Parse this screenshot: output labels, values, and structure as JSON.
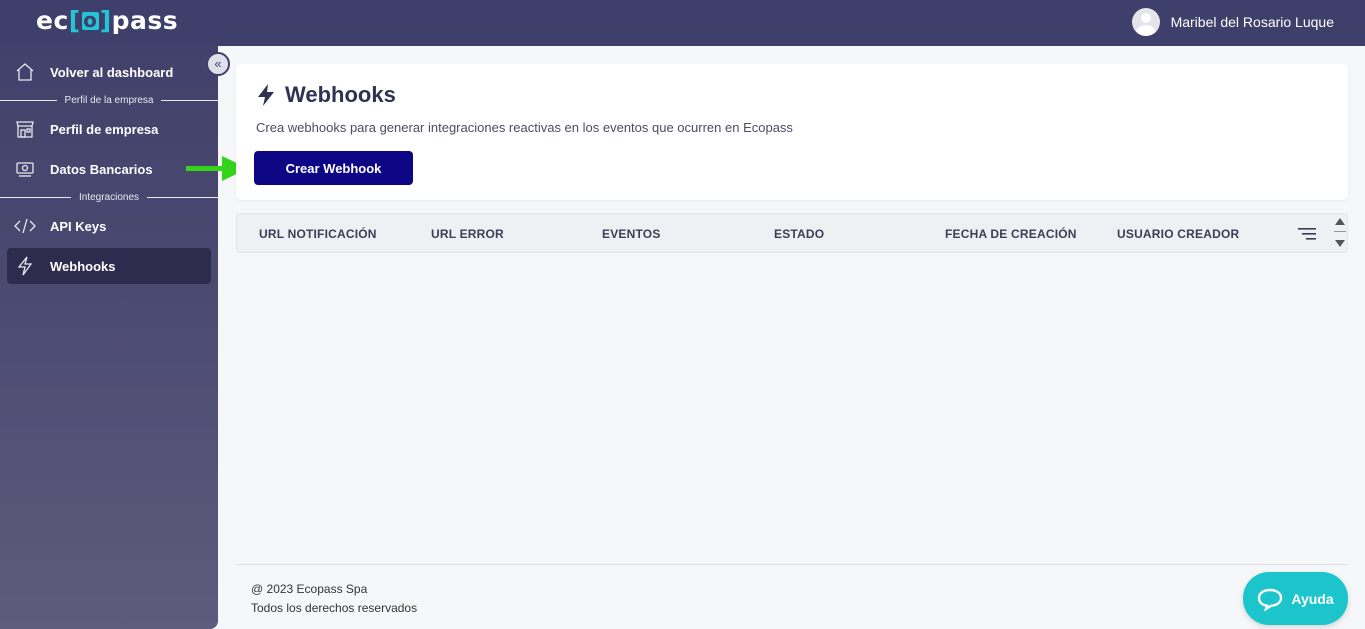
{
  "brand": {
    "logo_part1": "ec",
    "logo_bracket_open": "[",
    "logo_o": "o",
    "logo_bracket_close": "]",
    "logo_part2": "pass",
    "accent": "#22c4d6"
  },
  "header": {
    "user_name": "Maribel del Rosario Luque",
    "bg": "#3f3f6b"
  },
  "sidebar": {
    "collapse_icon": "«",
    "items": [
      {
        "label": "Volver al dashboard",
        "icon": "home-icon"
      },
      {
        "label": "Perfil de empresa",
        "icon": "store-icon"
      },
      {
        "label": "Datos Bancarios",
        "icon": "money-icon"
      },
      {
        "label": "API Keys",
        "icon": "code-icon"
      },
      {
        "label": "Webhooks",
        "icon": "bolt-icon",
        "active": true
      }
    ],
    "sections": [
      "Perfil de la empresa",
      "Integraciones"
    ]
  },
  "main": {
    "title": "Webhooks",
    "description": "Crea webhooks para generar integraciones reactivas en los eventos que ocurren en Ecopass",
    "create_button": "Crear Webhook",
    "button_color": "#0e0785"
  },
  "table": {
    "columns": [
      "URL NOTIFICACIÓN",
      "URL ERROR",
      "EVENTOS",
      "ESTADO",
      "FECHA DE CREACIÓN",
      "USUARIO CREADOR"
    ]
  },
  "footer": {
    "copyright": "@ 2023 Ecopass Spa",
    "rights": "Todos los derechos reservados"
  },
  "help": {
    "label": "Ayuda",
    "color": "#1cc5cb"
  }
}
